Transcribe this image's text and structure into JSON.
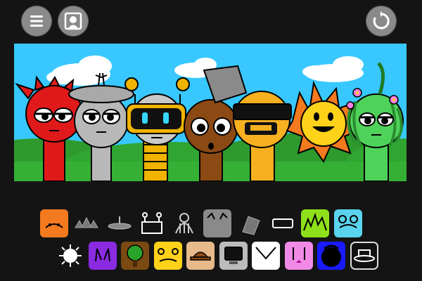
{
  "top_bar": {
    "menu_icon": "hamburger-menu-icon",
    "avatar_icon": "portrait-icon",
    "reset_icon": "refresh-icon"
  },
  "stage": {
    "sky_color": "#38c8ff",
    "ground_color": "#2fa82f",
    "characters": [
      {
        "name": "red-horned-character",
        "color": "#e01a1a"
      },
      {
        "name": "gray-satellite-character",
        "color": "#b8b8b8"
      },
      {
        "name": "robot-visor-character",
        "color": "#f0b400"
      },
      {
        "name": "brown-bucket-character",
        "color": "#8b4a14"
      },
      {
        "name": "orange-sunglasses-character",
        "color": "#f7b020"
      },
      {
        "name": "sun-smile-character",
        "color": "#ffd21a"
      },
      {
        "name": "green-flower-character",
        "color": "#4fd25a"
      }
    ]
  },
  "tray": {
    "row1": [
      {
        "name": "orange-sound-slot",
        "color": "#f47a1f"
      },
      {
        "name": "gray-spikes-slot",
        "color": "#777777"
      },
      {
        "name": "gray-dish-slot",
        "color": "#888888"
      },
      {
        "name": "robot-antenna-slot",
        "color": "#ffffff"
      },
      {
        "name": "gray-cage-slot",
        "color": "#bbbbbb"
      },
      {
        "name": "gray-cat-slot",
        "color": "#8a8a8a"
      },
      {
        "name": "gray-bucket-slot",
        "color": "#777777"
      },
      {
        "name": "visor-slot",
        "color": "#ffffff"
      },
      {
        "name": "lime-grass-slot",
        "color": "#8ee01a"
      },
      {
        "name": "cyan-bear-slot",
        "color": "#5ad3ee"
      }
    ],
    "row2": [
      {
        "name": "white-sun-slot",
        "color": "#ffffff"
      },
      {
        "name": "purple-ears-slot",
        "color": "#8a2be2"
      },
      {
        "name": "tree-slot",
        "color": "#7a4a12"
      },
      {
        "name": "yellow-drops-slot",
        "color": "#ffd21a"
      },
      {
        "name": "tan-hat-slot",
        "color": "#e8b98a"
      },
      {
        "name": "computer-slot",
        "color": "#bbbbbb"
      },
      {
        "name": "white-collar-slot",
        "color": "#ffffff"
      },
      {
        "name": "pink-bunny-slot",
        "color": "#f08ae6"
      },
      {
        "name": "blue-hood-slot",
        "color": "#1a1aff"
      },
      {
        "name": "black-hat-slot",
        "color": "#111111"
      }
    ]
  }
}
